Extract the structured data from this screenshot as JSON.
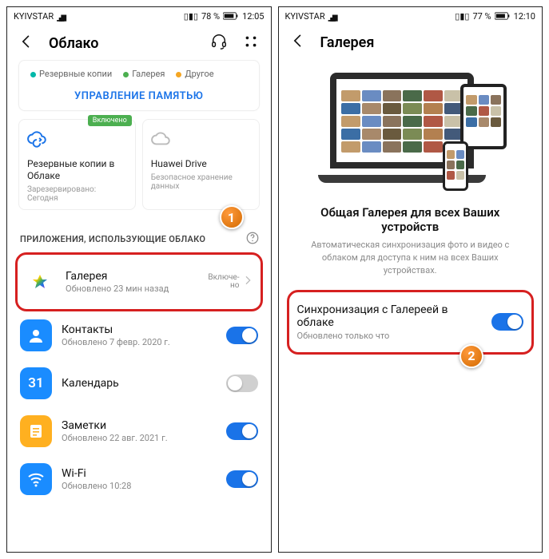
{
  "left": {
    "status": {
      "carrier": "KYIVSTAR",
      "battery_pct": "78 %",
      "time": "12:05"
    },
    "title": "Облако",
    "legend": {
      "a": "Резервные копии",
      "b": "Галерея",
      "c": "Другое"
    },
    "manage": "УПРАВЛЕНИЕ ПАМЯТЬЮ",
    "tiles": {
      "backup": {
        "badge": "Включено",
        "title": "Резервные копии в Облаке",
        "sub": "Зарезервировано: Сегодня"
      },
      "drive": {
        "title": "Huawei Drive",
        "sub": "Безопасное хранение данных"
      }
    },
    "section_hdr": "ПРИЛОЖЕНИЯ, ИСПОЛЬЗУЮЩИЕ ОБЛАКО",
    "apps": {
      "gallery": {
        "title": "Галерея",
        "sub": "Обновлено 23 мин назад",
        "state": "Включе-\nно"
      },
      "contacts": {
        "title": "Контакты",
        "sub": "Обновлено 7 февр. 2020 г."
      },
      "calendar": {
        "title": "Календарь",
        "sub": "",
        "day": "31"
      },
      "notes": {
        "title": "Заметки",
        "sub": "Обновлено 22 авг. 2021 г."
      },
      "wifi": {
        "title": "Wi-Fi",
        "sub": "Обновлено 10:28"
      }
    },
    "marker": "1"
  },
  "right": {
    "status": {
      "carrier": "KYIVSTAR",
      "battery_pct": "77 %",
      "time": "12:10"
    },
    "title": "Галерея",
    "hero_title": "Общая Галерея для всех Ваших устройств",
    "hero_sub": "Автоматическая синхронизация фото и видео с облаком для доступа к ним на всех Ваших устройствах.",
    "sync": {
      "title": "Синхронизация с Галереей в облаке",
      "sub": "Обновлено только что"
    },
    "marker": "2"
  },
  "colors": {
    "legend_a": "#00b8a9",
    "legend_b": "#4caf50",
    "legend_c": "#f5a623",
    "thumbs": [
      "#c29b6b",
      "#6a8cc2",
      "#8a735c",
      "#4a6a49",
      "#b05845",
      "#c9c1a8",
      "#3b6ea5",
      "#a8896b",
      "#6a5a3e",
      "#7b8b55",
      "#b38050",
      "#435a7a"
    ]
  }
}
